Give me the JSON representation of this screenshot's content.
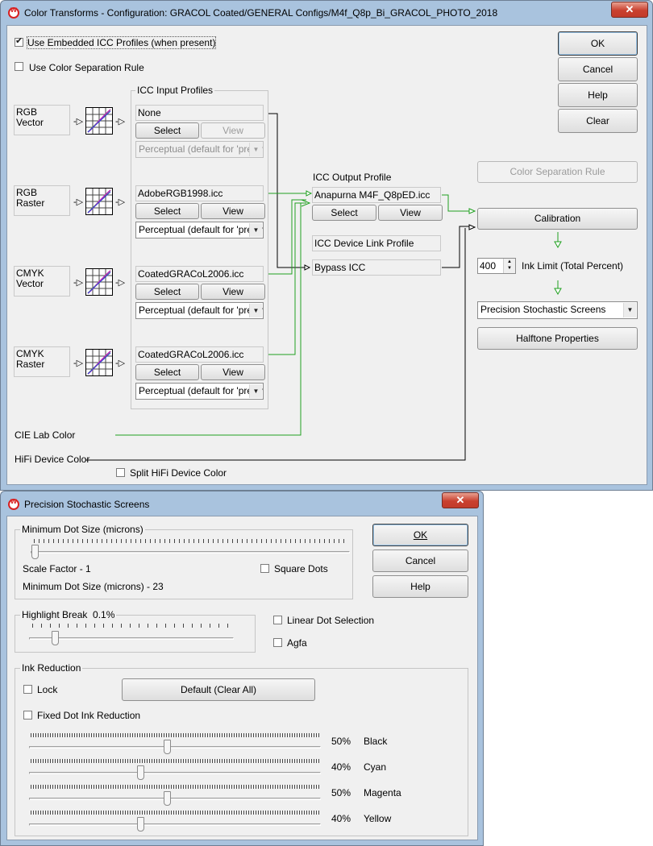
{
  "main_window": {
    "title": "Color Transforms - Configuration: GRACOL Coated/GENERAL Configs/M4f_Q8p_Bi_GRACOL_PHOTO_2018",
    "close_glyph": "✕",
    "use_embedded_label": "Use Embedded ICC Profiles (when present)",
    "use_embedded_checked": true,
    "use_separation_label": "Use Color Separation Rule",
    "use_separation_checked": false,
    "buttons": {
      "ok": "OK",
      "cancel": "Cancel",
      "help": "Help",
      "clear": "Clear"
    },
    "icc_input_label": "ICC Input Profiles",
    "inputs": [
      {
        "name": "RGB\nVector",
        "profile": "None",
        "select": "Select",
        "view": "View",
        "intent": "Perceptual (default for 'pretty",
        "view_enabled": false,
        "intent_enabled": false
      },
      {
        "name": "RGB\nRaster",
        "profile": "AdobeRGB1998.icc",
        "select": "Select",
        "view": "View",
        "intent": "Perceptual (default for 'pretty",
        "view_enabled": true,
        "intent_enabled": true
      },
      {
        "name": "CMYK\nVector",
        "profile": "CoatedGRACoL2006.icc",
        "select": "Select",
        "view": "View",
        "intent": "Perceptual (default for 'pretty",
        "view_enabled": true,
        "intent_enabled": true
      },
      {
        "name": "CMYK\nRaster",
        "profile": "CoatedGRACoL2006.icc",
        "select": "Select",
        "view": "View",
        "intent": "Perceptual (default for 'pretty",
        "view_enabled": true,
        "intent_enabled": true
      }
    ],
    "icc_output_label": "ICC Output Profile",
    "output_profile": "Anapurna M4F_Q8pED.icc",
    "output_select": "Select",
    "output_view": "View",
    "device_link_label": "ICC Device Link Profile",
    "bypass_icc": "Bypass ICC",
    "color_sep_rule_button": "Color Separation Rule",
    "calibration_button": "Calibration",
    "ink_limit_value": "400",
    "ink_limit_label": "Ink Limit (Total Percent)",
    "screening_selected": "Precision Stochastic Screens",
    "halftone_button": "Halftone Properties",
    "cie_lab_label": "CIE Lab Color",
    "hifi_label": "HiFi Device Color",
    "split_hifi_label": "Split HiFi Device Color",
    "split_hifi_checked": false,
    "accent_green": "#1fa01f",
    "wire_black": "#000000"
  },
  "screens_window": {
    "title": "Precision Stochastic Screens",
    "close_glyph": "✕",
    "min_dot_group": "Minimum Dot Size (microns)",
    "min_dot_slider_fraction": 0.0,
    "scale_factor": "Scale Factor - 1",
    "min_dot_size_text": "Minimum Dot Size (microns) - 23",
    "square_dots_label": "Square Dots",
    "square_dots_checked": false,
    "buttons": {
      "ok": "OK",
      "cancel": "Cancel",
      "help": "Help"
    },
    "highlight_break_label": "Highlight Break",
    "highlight_break_value": "0.1%",
    "highlight_slider_fraction": 0.13,
    "linear_dot_label": "Linear Dot Selection",
    "linear_dot_checked": false,
    "agfa_label": "Agfa",
    "agfa_checked": false,
    "ink_reduction_group": "Ink Reduction",
    "lock_label": "Lock",
    "lock_checked": false,
    "default_button": "Default (Clear All)",
    "fixed_dot_label": "Fixed Dot Ink Reduction",
    "fixed_dot_checked": false,
    "inks": [
      {
        "percent": "50%",
        "name": "Black",
        "fraction": 0.5
      },
      {
        "percent": "40%",
        "name": "Cyan",
        "fraction": 0.4
      },
      {
        "percent": "50%",
        "name": "Magenta",
        "fraction": 0.5
      },
      {
        "percent": "40%",
        "name": "Yellow",
        "fraction": 0.4
      }
    ]
  }
}
